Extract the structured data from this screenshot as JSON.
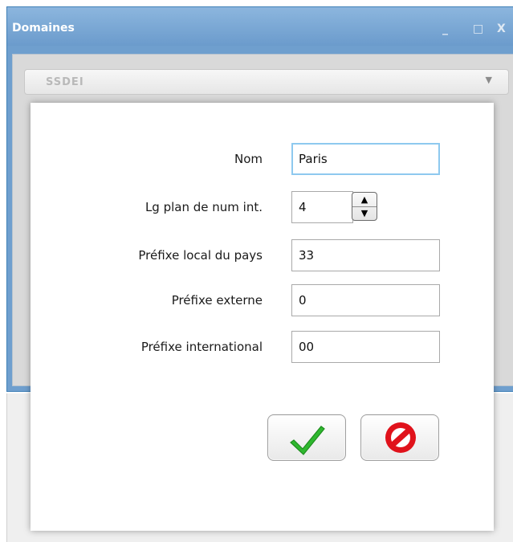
{
  "background_window": {
    "title": "Domaines",
    "controls": {
      "minimize": "_",
      "maximize": "□",
      "close": "X"
    },
    "combo_value": "SSDEI",
    "combo_arrow": "▼"
  },
  "dialog": {
    "fields": [
      {
        "label": "Nom",
        "value": "Paris"
      },
      {
        "label": "Lg plan de num int.",
        "value": "4"
      },
      {
        "label": "Préfixe local du pays",
        "value": "33"
      },
      {
        "label": "Préfixe externe",
        "value": "0"
      },
      {
        "label": "Préfixe international",
        "value": "00"
      }
    ],
    "spinner": {
      "up": "▲",
      "down": "▼"
    },
    "buttons": {
      "ok_icon": "checkmark-icon",
      "cancel_icon": "no-entry-icon"
    }
  },
  "colors": {
    "titlebar": "#6b9bcc",
    "focus_border": "#8ec9ef",
    "ok_green": "#2fb82f",
    "cancel_red": "#e0121b"
  }
}
